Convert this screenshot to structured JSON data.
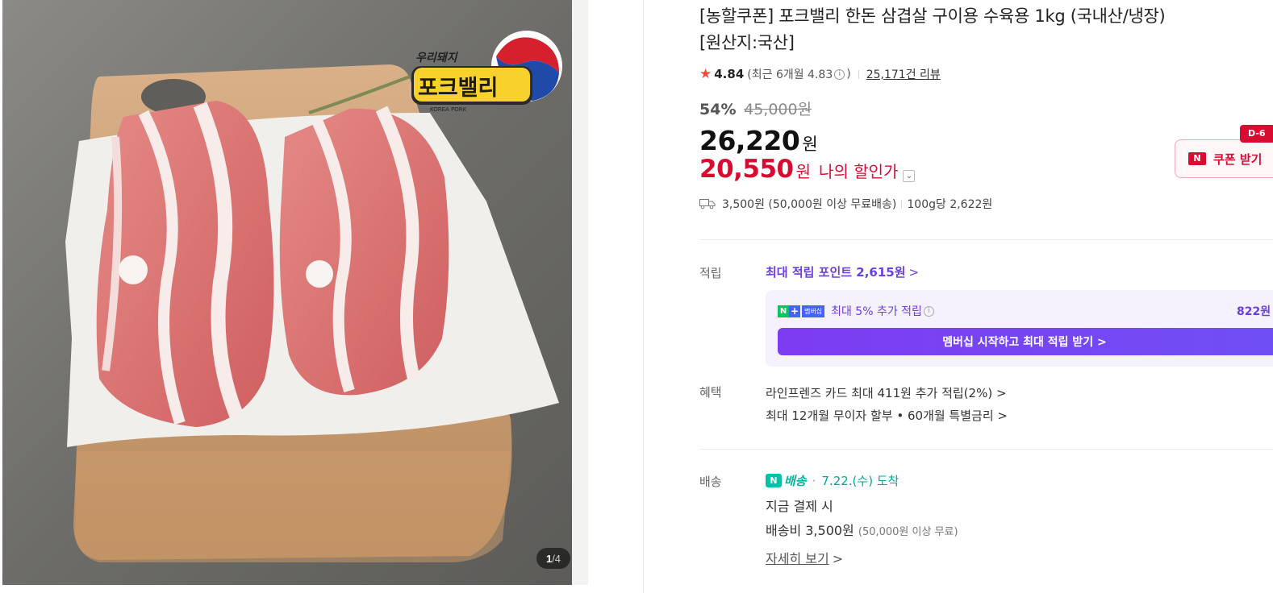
{
  "gallery": {
    "current": "1",
    "total": "/4",
    "logo": {
      "top": "우리돼지",
      "main": "포크밸리",
      "sub": "KOREA PORK"
    }
  },
  "product": {
    "title_line1": "[농할쿠폰] 포크밸리 한돈 삼겹살 구이용 수육용 1kg (국내산/냉장)",
    "title_line2": "[원산지:국산]"
  },
  "rating": {
    "star": "★",
    "score": "4.84",
    "recent_prefix": "(최근 6개월 4.83",
    "recent_info_icon": "i",
    "recent_suffix": ")",
    "reviews": "25,171건 리뷰"
  },
  "discount": {
    "percent": "54%",
    "original": "45,000원"
  },
  "price": {
    "amount": "26,220",
    "unit": "원"
  },
  "my_price": {
    "amount": "20,550",
    "unit": "원",
    "label": "나의 할인가"
  },
  "coupon": {
    "badge": "N",
    "label": "쿠폰 받기",
    "dday": "D-6"
  },
  "shipping_summary": {
    "fee": "3,500원 (50,000원 이상 무료배송)",
    "unit_price": "100g당 2,622원"
  },
  "points": {
    "label": "적립",
    "max_points": "최대 적립 포인트 2,615원",
    "membership_badge": {
      "n": "N",
      "plus": "+",
      "text": "멤버십"
    },
    "membership_text": "최대 5% 추가 적립",
    "membership_amount": "822원",
    "membership_cta": "멤버십 시작하고 최대 적립 받기 >"
  },
  "benefits": {
    "label": "혜택",
    "card": "라인프렌즈 카드 최대 411원 추가 적립(2%) >",
    "installment": "최대 12개월 무이자 할부 • 60개월 특별금리 >"
  },
  "delivery": {
    "label": "배송",
    "npay_badge": "N",
    "npay_label": "배송",
    "separator": "·",
    "arrival": "7.22.(수) 도착",
    "payment_note": "지금 결제 시",
    "fee": "배송비 3,500원",
    "fee_note": "(50,000원 이상 무료)",
    "details": "자세히 보기"
  },
  "colors": {
    "price_red": "#d80c30",
    "accent_purple": "#6a3fdc",
    "star": "#f04b3b",
    "npay_green": "#03c1a6"
  }
}
